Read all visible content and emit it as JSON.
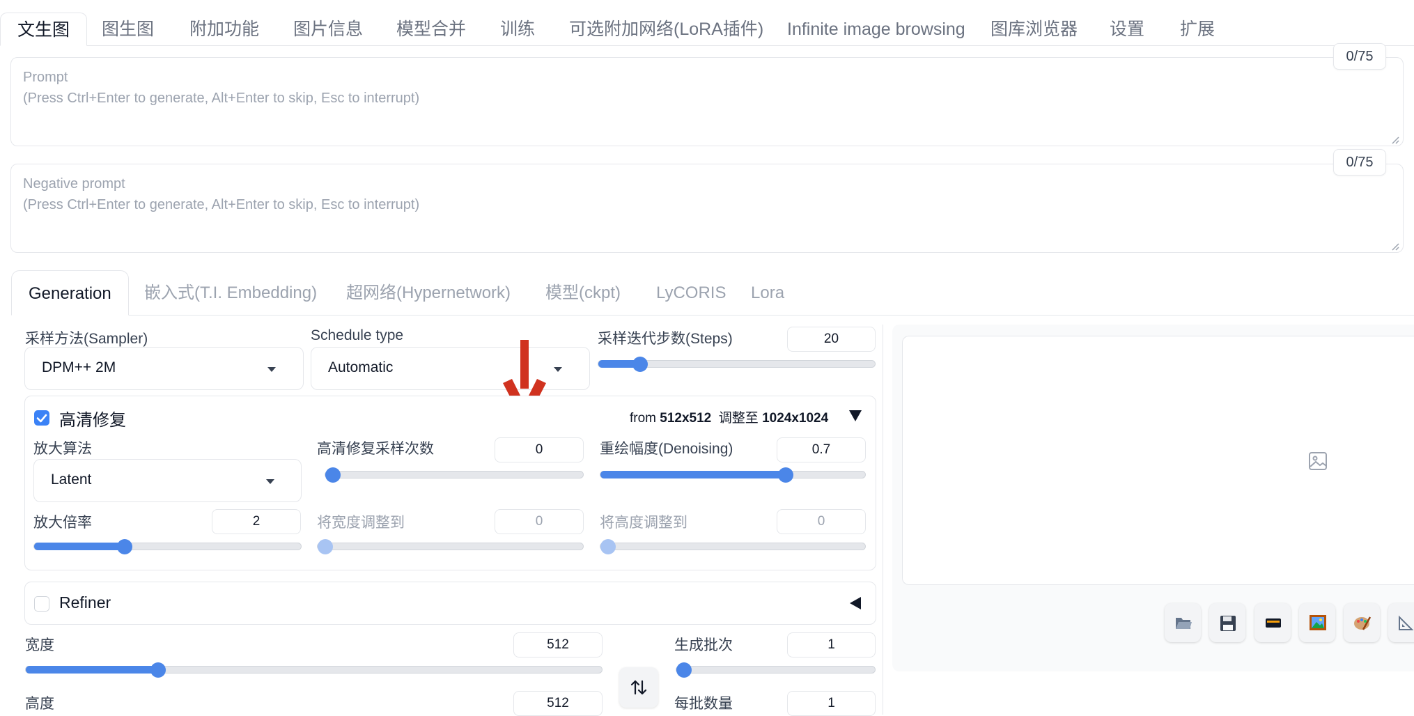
{
  "top_tabs": [
    "文生图",
    "图生图",
    "附加功能",
    "图片信息",
    "模型合并",
    "训练",
    "可选附加网络(LoRA插件)",
    "Infinite image browsing",
    "图库浏览器",
    "设置",
    "扩展"
  ],
  "prompt": {
    "label": "Prompt",
    "hint": "(Press Ctrl+Enter to generate, Alt+Enter to skip, Esc to interrupt)",
    "counter": "0/75"
  },
  "negative_prompt": {
    "label": "Negative prompt",
    "hint": "(Press Ctrl+Enter to generate, Alt+Enter to skip, Esc to interrupt)",
    "counter": "0/75"
  },
  "sub_tabs": [
    "Generation",
    "嵌入式(T.I. Embedding)",
    "超网络(Hypernetwork)",
    "模型(ckpt)",
    "LyCORIS",
    "Lora"
  ],
  "sampler": {
    "label": "采样方法(Sampler)",
    "value": "DPM++ 2M"
  },
  "schedule": {
    "label": "Schedule type",
    "value": "Automatic"
  },
  "steps": {
    "label": "采样迭代步数(Steps)",
    "value": "20",
    "fraction": 0.15
  },
  "hires": {
    "title": "高清修复",
    "checked": true,
    "summary_from": "from ",
    "summary_from_size": "512x512",
    "summary_to": "  调整至 ",
    "summary_to_size": "1024x1024",
    "upscaler": {
      "label": "放大算法",
      "value": "Latent"
    },
    "hires_steps": {
      "label": "高清修复采样次数",
      "value": "0",
      "fraction": 0.0
    },
    "denoising": {
      "label": "重绘幅度(Denoising)",
      "value": "0.7",
      "fraction": 0.7
    },
    "upscale_by": {
      "label": "放大倍率",
      "value": "2",
      "fraction": 0.34
    },
    "resize_width": {
      "label": "将宽度调整到",
      "value": "0",
      "fraction": 0.0
    },
    "resize_height": {
      "label": "将高度调整到",
      "value": "0",
      "fraction": 0.0
    }
  },
  "refiner": {
    "label": "Refiner",
    "checked": false
  },
  "width": {
    "label": "宽度",
    "value": "512",
    "fraction": 0.23
  },
  "height": {
    "label": "高度",
    "value": "512"
  },
  "batch_count": {
    "label": "生成批次",
    "value": "1",
    "fraction": 0.0
  },
  "batch_size": {
    "label": "每批数量",
    "value": "1"
  },
  "colors": {
    "accent": "#4b86e8",
    "arrow": "#d0321f",
    "checkbox": "#3b82f6"
  },
  "icons": {
    "image_placeholder": "image-icon",
    "swap": "swap-arrows-icon",
    "tools": [
      "folder-icon",
      "save-icon",
      "zip-icon",
      "picture-icon",
      "palette-icon",
      "ruler-icon"
    ]
  }
}
